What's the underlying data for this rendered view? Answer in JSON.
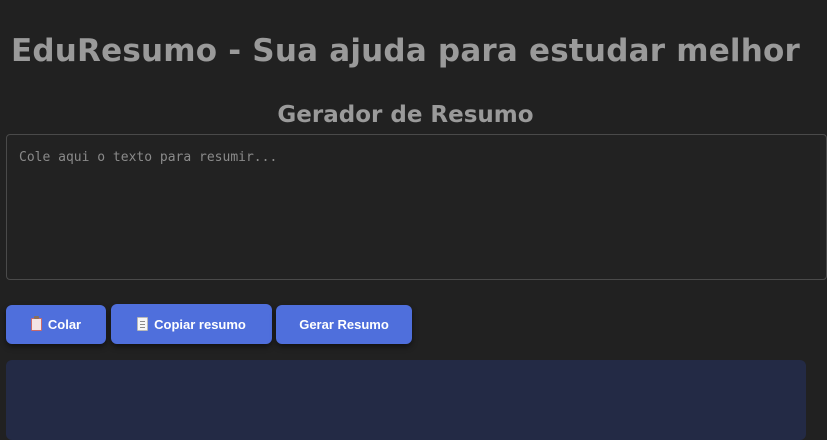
{
  "header": {
    "title": "EduResumo - Sua ajuda para estudar melhor"
  },
  "generator": {
    "section_title": "Gerador de Resumo",
    "textarea": {
      "placeholder": "Cole aqui o texto para resumir...",
      "value": ""
    },
    "buttons": {
      "paste": {
        "label": "Colar",
        "icon": "clipboard-icon"
      },
      "copy": {
        "label": "Copiar resumo",
        "icon": "document-icon"
      },
      "generate": {
        "label": "Gerar Resumo"
      }
    }
  },
  "colors": {
    "background": "#212121",
    "title_text": "#9a9a9a",
    "button": "#4f6fdc",
    "result_panel": "#232a45"
  }
}
